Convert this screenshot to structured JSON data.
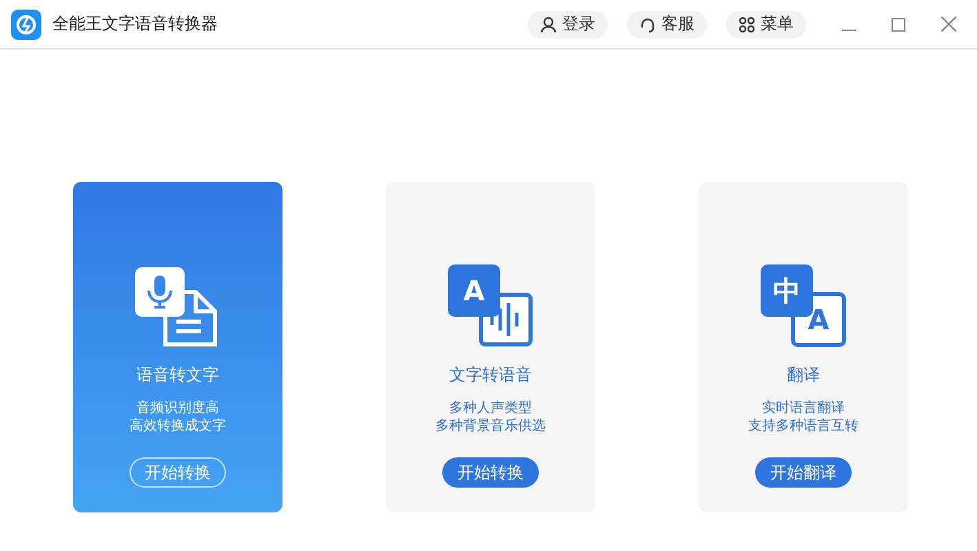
{
  "window": {
    "title": "全能王文字语音转换器"
  },
  "header_buttons": [
    {
      "kind": "user",
      "label": "登录"
    },
    {
      "kind": "headset",
      "label": "客服"
    },
    {
      "kind": "grid",
      "label": "菜单"
    }
  ],
  "cards": [
    {
      "kind": "speech",
      "selected": true,
      "title": "语音转文字",
      "lines": [
        "音频识别度高",
        "高效转换成文字"
      ],
      "button": "开始转换"
    },
    {
      "kind": "tts",
      "selected": false,
      "glyph": "A",
      "title": "文字转语音",
      "lines": [
        "多种人声类型",
        "多种背景音乐供选"
      ],
      "button": "开始转换"
    },
    {
      "kind": "translate",
      "selected": false,
      "glyph": "中",
      "glyph2": "A",
      "title": "翻译",
      "lines": [
        "实时语言翻译",
        "支持多种语言互转"
      ],
      "button": "开始翻译"
    }
  ]
}
